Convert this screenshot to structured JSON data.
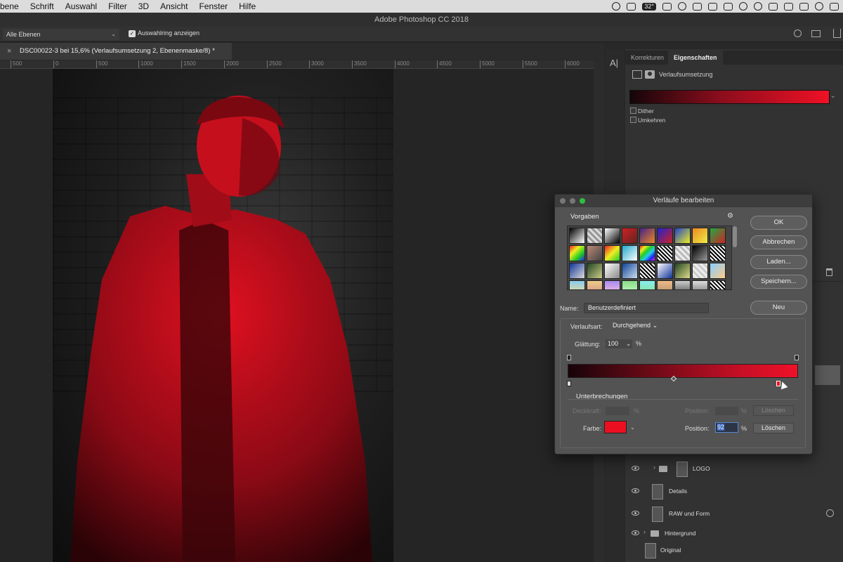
{
  "menubar": {
    "items": [
      "bene",
      "Schrift",
      "Auswahl",
      "Filter",
      "3D",
      "Ansicht",
      "Fenster",
      "Hilfe"
    ],
    "temperature": "32°"
  },
  "app_title": "Adobe Photoshop CC 2018",
  "options": {
    "layer_select": "Alle Ebenen",
    "show_ring_label": "Auswahlring anzeigen"
  },
  "document_tab": "DSC00022-3 bei 15,6% (Verlaufsumsetzung 2, Ebenenmaske/8) *",
  "ruler_ticks": [
    "500",
    "0",
    "500",
    "1000",
    "1500",
    "2000",
    "2500",
    "3000",
    "3500",
    "4000",
    "4500",
    "5000",
    "5500",
    "6000"
  ],
  "properties": {
    "tabs": [
      "Korrekturen",
      "Eigenschaften"
    ],
    "adjustment_name": "Verlaufsumsetzung",
    "dither_label": "Dither",
    "reverse_label": "Umkehren",
    "colors": {
      "start": "#140609",
      "end": "#ef1125"
    }
  },
  "layers": [
    {
      "name": "LOGO"
    },
    {
      "name": "Details"
    },
    {
      "name": "RAW und Form"
    },
    {
      "name": "Hintergrund"
    },
    {
      "name": "Original"
    }
  ],
  "dialog": {
    "title": "Verläufe bearbeiten",
    "presets_label": "Vorgaben",
    "buttons": {
      "ok": "OK",
      "cancel": "Abbrechen",
      "load": "Laden...",
      "save": "Speichern...",
      "new": "Neu"
    },
    "name_label": "Name:",
    "name_value": "Benutzerdefiniert",
    "type_label": "Verlaufsart:",
    "type_value": "Durchgehend",
    "smoothness_label": "Glättung:",
    "smoothness_value": "100",
    "percent": "%",
    "stops_label": "Unterbrechungen",
    "opacity_label": "Deckkraft:",
    "position_label": "Position:",
    "delete_label": "Löschen",
    "color_label": "Farbe:",
    "position_value": "92",
    "stop_color": "#ec0f22"
  }
}
